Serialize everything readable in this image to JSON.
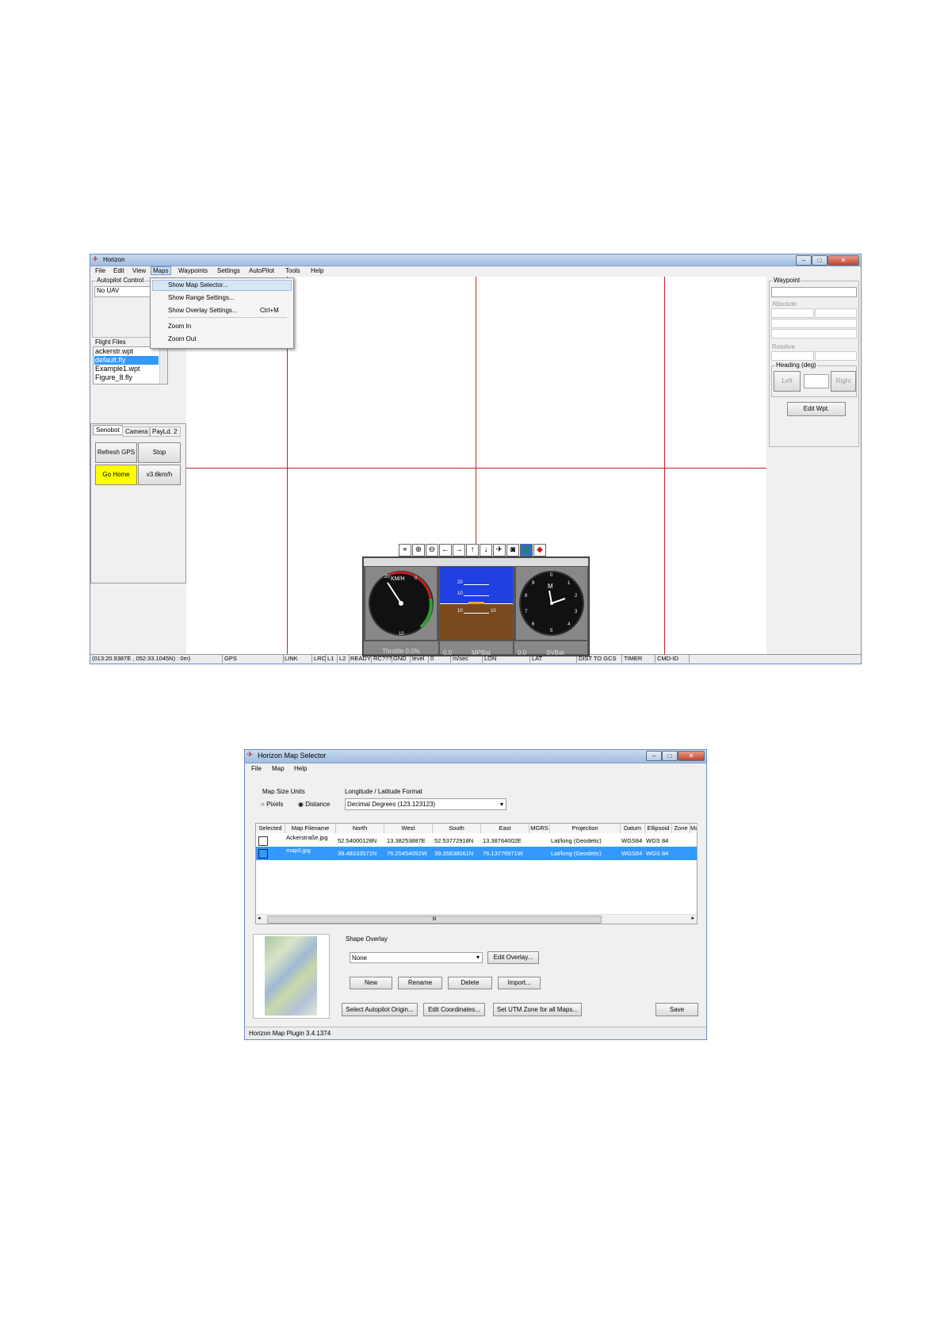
{
  "win1": {
    "title": "Horizon",
    "menu": [
      "File",
      "Edit",
      "View",
      "Maps",
      "Waypoints",
      "Settings",
      "AutoPilot",
      "Tools",
      "Help"
    ],
    "dropdown": {
      "items": [
        "Show Map Selector...",
        "Show Range Settings...",
        "Show Overlay Settings...",
        "Zoom In",
        "Zoom Out"
      ],
      "shortcut": "Ctrl+M"
    },
    "autopilot": {
      "label": "Autopilot Control",
      "value": "No UAV"
    },
    "flight_files": {
      "label": "Flight Files",
      "items": [
        "ackerstr.wpt",
        "default.fly",
        "Example1.wpt",
        "Figure_8.fly"
      ],
      "selected": 1
    },
    "tabs": [
      "Senobot",
      "Camera",
      "PayLd. 2"
    ],
    "buttons": {
      "refresh_gps": "Refresh GPS",
      "stop": "Stop",
      "go_home": "Go Home",
      "speed": "v3.6km/h"
    },
    "waypoint": {
      "label": "Waypoint",
      "absolute": "Absolute",
      "relative": "Relative",
      "heading_label": "Heading (deg)",
      "left": "Left",
      "right": "Right",
      "edit": "Edit Wpt."
    },
    "instruments": {
      "speed_unit": "KM/H",
      "speed_ticks": [
        "20",
        "0",
        "10"
      ],
      "att_ticks": [
        "20",
        "10",
        "10",
        "10"
      ],
      "clock_letter": "M",
      "clock_nums": [
        "0",
        "1",
        "2",
        "3",
        "4",
        "5",
        "6",
        "7",
        "8",
        "9"
      ],
      "throttle": "Throttle 0.0%",
      "mpbat_val": "0.0",
      "mpbat": "MPBat",
      "svbat_val": "0.0",
      "svbat": "SVBat"
    },
    "status": [
      "(013:20.9387E , 052:33.1045N) : 0m)",
      "GPS",
      "LINK",
      "LRC",
      "L1",
      "L2",
      "READY",
      "RC???",
      "GND",
      "level",
      "0",
      "m/sec",
      "LON",
      "LAT",
      "DIST TO GCS",
      "TIMER",
      "CMD-ID"
    ]
  },
  "win2": {
    "title": "Horizon Map Selector",
    "menu": [
      "File",
      "Map",
      "Help"
    ],
    "units_label": "Map Size Units",
    "pixels": "Pixels",
    "distance": "Distance",
    "format_label": "Longitude / Latitude Format",
    "format_value": "Decimal Degrees (123.123123)",
    "columns": [
      "Selected",
      "Map Filename",
      "North",
      "West",
      "South",
      "East",
      "MGRS",
      "Projection",
      "Datum",
      "Ellipsoid",
      "Zone",
      "Map"
    ],
    "rows": [
      [
        "",
        "Ackerstraße.jpg",
        "52.54000128N",
        "13.38253887E",
        "52.53772918N",
        "13.38764002E",
        "",
        "Lat/long (Geodetic)",
        "WGS84",
        "WGS 84"
      ],
      [
        "",
        "map0.jpg",
        "39.48333571N",
        "76.25454092W",
        "39.35838061N",
        "76.13776971W",
        "",
        "Lat/long (Geodetic)",
        "WGS84",
        "WGS 84"
      ]
    ],
    "scroll_mark": "III",
    "overlay_label": "Shape Overlay",
    "overlay_value": "None",
    "buttons": {
      "edit_overlay": "Edit Overlay...",
      "new": "New",
      "rename": "Rename",
      "delete": "Delete",
      "import": "Import...",
      "autopilot_origin": "Select Autopilot Origin...",
      "edit_coords": "Edit Coordinates...",
      "utm": "Set UTM Zone for all Maps...",
      "save": "Save"
    },
    "status": "Horizon Map Plugin 3.4.1374"
  },
  "colors": {
    "map_line": "#c4222a",
    "selection": "#3399ff",
    "go_home": "#ffff00",
    "attitude_sky": "#1f3fe0",
    "attitude_ground": "#7a4a1e"
  }
}
